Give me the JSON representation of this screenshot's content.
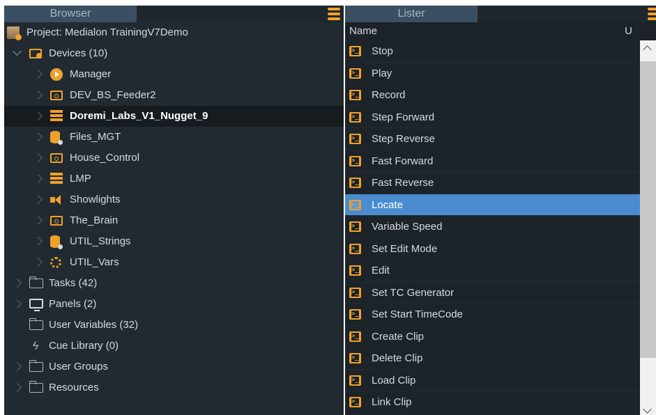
{
  "browser": {
    "title": "Browser",
    "tree": [
      {
        "label": "Project: Medialon TrainingV7Demo",
        "icon": "project-icon",
        "indent": 0,
        "chevron": "none"
      },
      {
        "label": "Devices (10)",
        "icon": "device-folder-icon",
        "indent": 1,
        "chevron": "down"
      },
      {
        "label": "Manager",
        "icon": "manager-play-icon",
        "indent": 2,
        "chevron": "right"
      },
      {
        "label": "DEV_BS_Feeder2",
        "icon": "device-box-icon",
        "indent": 2,
        "chevron": "right"
      },
      {
        "label": "Doremi_Labs_V1_Nugget_9",
        "icon": "server-icon",
        "indent": 2,
        "chevron": "right",
        "selected": true
      },
      {
        "label": "Files_MGT",
        "icon": "database-icon",
        "indent": 2,
        "chevron": "right"
      },
      {
        "label": "House_Control",
        "icon": "device-box-icon",
        "indent": 2,
        "chevron": "right"
      },
      {
        "label": "LMP",
        "icon": "server-icon",
        "indent": 2,
        "chevron": "right"
      },
      {
        "label": "Showlights",
        "icon": "speaker-icon",
        "indent": 2,
        "chevron": "right"
      },
      {
        "label": "The_Brain",
        "icon": "device-box-icon",
        "indent": 2,
        "chevron": "right"
      },
      {
        "label": "UTIL_Strings",
        "icon": "database-icon",
        "indent": 2,
        "chevron": "right"
      },
      {
        "label": "UTIL_Vars",
        "icon": "gear-icon",
        "indent": 2,
        "chevron": "right"
      },
      {
        "label": "Tasks (42)",
        "icon": "tasks-folder-icon",
        "indent": 1,
        "chevron": "right"
      },
      {
        "label": "Panels (2)",
        "icon": "monitor-icon",
        "indent": 1,
        "chevron": "right"
      },
      {
        "label": "User Variables (32)",
        "icon": "variables-folder-icon",
        "indent": 1,
        "chevron": "none"
      },
      {
        "label": "Cue Library (0)",
        "icon": "bolt-icon",
        "indent": 1,
        "chevron": "none"
      },
      {
        "label": "User Groups",
        "icon": "folder-icon",
        "indent": 1,
        "chevron": "right"
      },
      {
        "label": "Resources",
        "icon": "folder-icon",
        "indent": 1,
        "chevron": "right"
      }
    ]
  },
  "lister": {
    "title": "Lister",
    "columns": {
      "name": "Name",
      "u": "U"
    },
    "items": [
      {
        "label": "Stop"
      },
      {
        "label": "Play"
      },
      {
        "label": "Record"
      },
      {
        "label": "Step Forward"
      },
      {
        "label": "Step Reverse"
      },
      {
        "label": "Fast Forward"
      },
      {
        "label": "Fast Reverse"
      },
      {
        "label": "Locate",
        "selected": true
      },
      {
        "label": "Variable Speed"
      },
      {
        "label": "Set Edit Mode"
      },
      {
        "label": "Edit"
      },
      {
        "label": "Set TC Generator"
      },
      {
        "label": "Set Start TimeCode"
      },
      {
        "label": "Create Clip"
      },
      {
        "label": "Delete Clip"
      },
      {
        "label": "Load Clip"
      },
      {
        "label": "Link Clip"
      }
    ]
  },
  "colors": {
    "accent": "#f0a12b",
    "selection": "#4a8ccf",
    "panel": "#222a31"
  }
}
